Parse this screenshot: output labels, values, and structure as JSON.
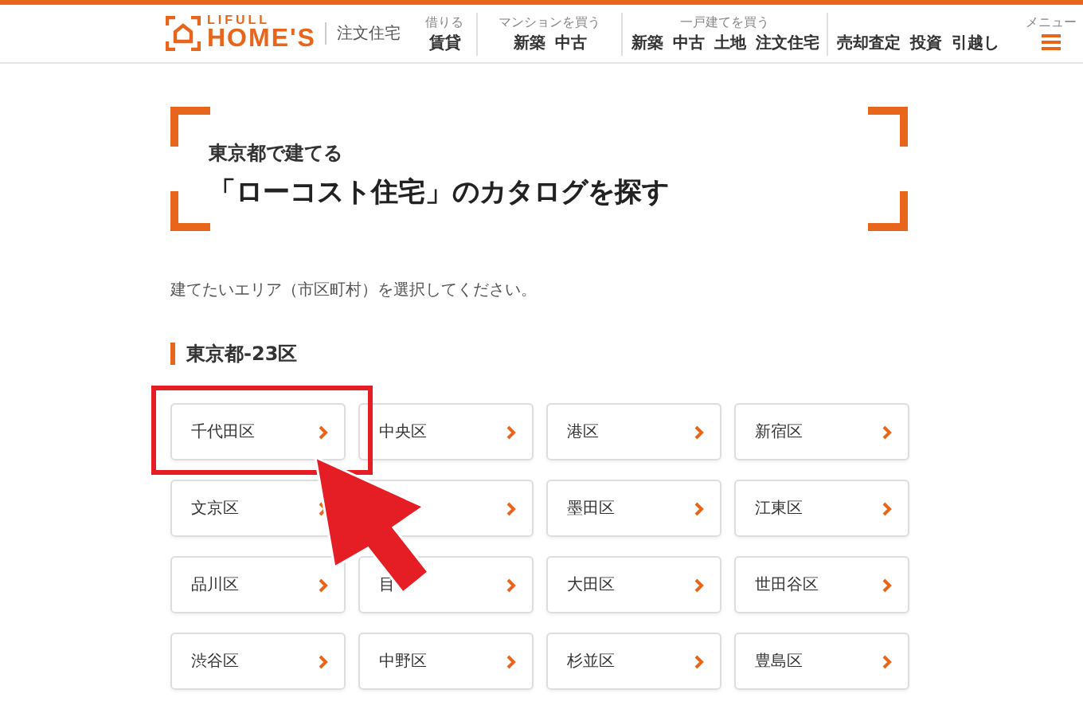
{
  "header": {
    "logo": {
      "top": "LIFULL",
      "main": "HOME'S"
    },
    "site_label": "注文住宅",
    "nav": [
      {
        "caption": "借りる",
        "items": [
          "賃貸"
        ]
      },
      {
        "caption": "マンションを買う",
        "items": [
          "新築",
          "中古"
        ]
      },
      {
        "caption": "一戸建てを買う",
        "items": [
          "新築",
          "中古",
          "土地",
          "注文住宅"
        ]
      },
      {
        "items": [
          "売却査定",
          "投資",
          "引越し"
        ]
      }
    ],
    "menu": {
      "caption": "メニュー"
    }
  },
  "hero": {
    "subtitle": "東京都で建てる",
    "title": "「ローコスト住宅」のカタログを探す"
  },
  "instruction": "建てたいエリア（市区町村）を選択してください。",
  "section": {
    "heading": "東京都-23区",
    "areas": [
      {
        "kind": "named",
        "label": "千代田区"
      },
      {
        "kind": "named",
        "label": "中央区"
      },
      {
        "kind": "named",
        "label": "港区"
      },
      {
        "kind": "named",
        "label": "新宿区"
      },
      {
        "kind": "named",
        "label": "文京区"
      },
      {
        "kind": "covered"
      },
      {
        "kind": "named",
        "label": "墨田区"
      },
      {
        "kind": "named",
        "label": "江東区"
      },
      {
        "kind": "named",
        "label": "品川区"
      },
      {
        "kind": "named",
        "label": "目"
      },
      {
        "kind": "named",
        "label": "大田区"
      },
      {
        "kind": "named",
        "label": "世田谷区"
      },
      {
        "kind": "named",
        "label": "渋谷区"
      },
      {
        "kind": "named",
        "label": "中野区"
      },
      {
        "kind": "named",
        "label": "杉並区"
      },
      {
        "kind": "named",
        "label": "豊島区"
      }
    ]
  }
}
